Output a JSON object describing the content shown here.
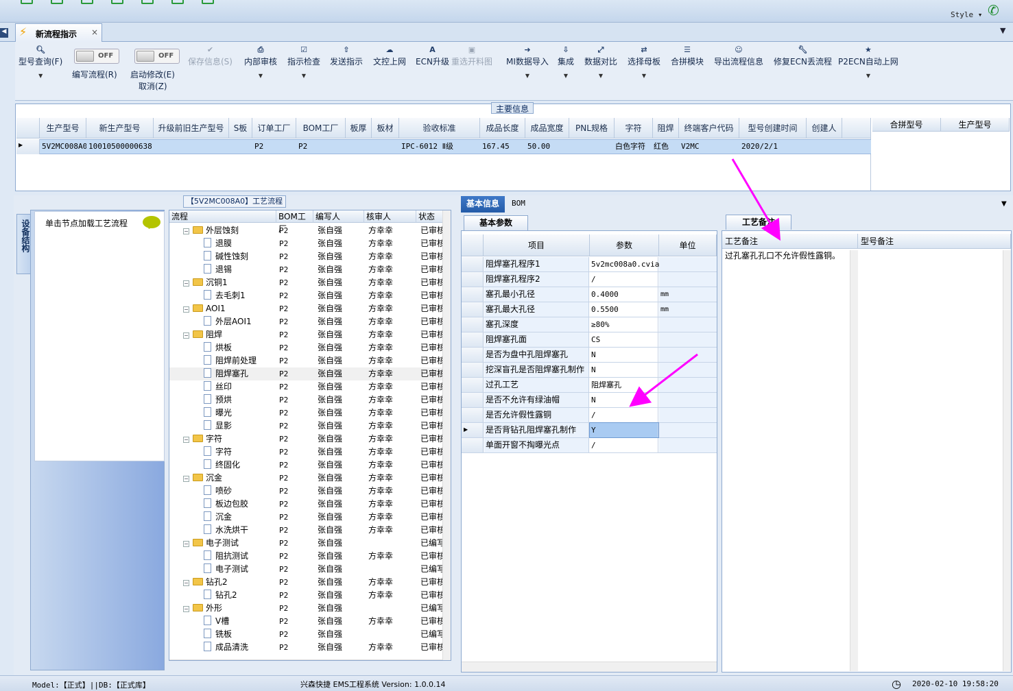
{
  "topbar": {
    "style_label": "Style",
    "style_arrow": "▾",
    "phone_icon": "phone-icon"
  },
  "tab": {
    "title": "新流程指示",
    "close": "×"
  },
  "ribbon": {
    "type_query": "型号查询(F)",
    "write_toggle": "OFF",
    "write_label": "编写流程(R)",
    "modify_toggle": "OFF",
    "modify_label": "启动修改(E)",
    "cancel_label": "取消(Z)",
    "save_info": "保存信息(S)",
    "internal_review": "内部审核",
    "indicate_check": "指示检查",
    "send_indicate": "发送指示",
    "doc_upload": "文控上网",
    "ecn_upgrade": "ECN升级",
    "reselect_cut": "重选开料图",
    "mi_import": "MI数据导入",
    "integrate": "集成",
    "data_compare": "数据对比",
    "select_mother": "选择母板",
    "merge_module": "合拼模块",
    "export_info": "导出流程信息",
    "fix_ecn": "修复ECN丢流程",
    "p2ecn": "P2ECN自动上网"
  },
  "main_info": {
    "title": "主要信息",
    "headers": [
      "生产型号",
      "新生产型号",
      "升级前旧生产型号",
      "S板",
      "订单工厂",
      "BOM工厂",
      "板厚",
      "板材",
      "验收标准",
      "成品长度",
      "成品宽度",
      "PNL规格",
      "字符",
      "阻焊",
      "终端客户代码",
      "型号创建时间",
      "创建人"
    ],
    "row": [
      "5V2MC008A0",
      "10010500000638",
      "",
      "",
      "P2",
      "P2",
      "",
      "",
      "IPC-6012 Ⅱ级",
      "167.45",
      "50.00",
      "",
      "白色字符",
      "红色",
      "V2MC",
      "2020/2/1",
      ""
    ],
    "merge_headers": [
      "合拼型号",
      "生产型号"
    ]
  },
  "device_panel": {
    "tab_label": "设备结构",
    "load_hint": "单击节点加载工艺流程"
  },
  "process": {
    "title": "【5V2MC008A0】工艺流程",
    "headers": [
      "流程",
      "BOM工厂",
      "编写人",
      "核审人",
      "状态"
    ],
    "rows": [
      {
        "name": "外层蚀刻",
        "bom": "P2",
        "writer": "张自强",
        "reviewer": "方幸幸",
        "status": "已审核"
      },
      {
        "name": "退膜",
        "bom": "P2",
        "writer": "张自强",
        "reviewer": "方幸幸",
        "status": "已审核"
      },
      {
        "name": "碱性蚀刻",
        "bom": "P2",
        "writer": "张自强",
        "reviewer": "方幸幸",
        "status": "已审核"
      },
      {
        "name": "退锡",
        "bom": "P2",
        "writer": "张自强",
        "reviewer": "方幸幸",
        "status": "已审核"
      },
      {
        "name": "沉铜1",
        "bom": "P2",
        "writer": "张自强",
        "reviewer": "方幸幸",
        "status": "已审核"
      },
      {
        "name": "去毛刺1",
        "bom": "P2",
        "writer": "张自强",
        "reviewer": "方幸幸",
        "status": "已审核"
      },
      {
        "name": "AOI1",
        "bom": "P2",
        "writer": "张自强",
        "reviewer": "方幸幸",
        "status": "已审核"
      },
      {
        "name": "外层AOI1",
        "bom": "P2",
        "writer": "张自强",
        "reviewer": "方幸幸",
        "status": "已审核"
      },
      {
        "name": "阻焊",
        "bom": "P2",
        "writer": "张自强",
        "reviewer": "方幸幸",
        "status": "已审核"
      },
      {
        "name": "烘板",
        "bom": "P2",
        "writer": "张自强",
        "reviewer": "方幸幸",
        "status": "已审核"
      },
      {
        "name": "阻焊前处理",
        "bom": "P2",
        "writer": "张自强",
        "reviewer": "方幸幸",
        "status": "已审核"
      },
      {
        "name": "阻焊塞孔",
        "bom": "P2",
        "writer": "张自强",
        "reviewer": "方幸幸",
        "status": "已审核"
      },
      {
        "name": "丝印",
        "bom": "P2",
        "writer": "张自强",
        "reviewer": "方幸幸",
        "status": "已审核"
      },
      {
        "name": "预烘",
        "bom": "P2",
        "writer": "张自强",
        "reviewer": "方幸幸",
        "status": "已审核"
      },
      {
        "name": "曝光",
        "bom": "P2",
        "writer": "张自强",
        "reviewer": "方幸幸",
        "status": "已审核"
      },
      {
        "name": "显影",
        "bom": "P2",
        "writer": "张自强",
        "reviewer": "方幸幸",
        "status": "已审核"
      },
      {
        "name": "字符",
        "bom": "P2",
        "writer": "张自强",
        "reviewer": "方幸幸",
        "status": "已审核"
      },
      {
        "name": "字符",
        "bom": "P2",
        "writer": "张自强",
        "reviewer": "方幸幸",
        "status": "已审核"
      },
      {
        "name": "终固化",
        "bom": "P2",
        "writer": "张自强",
        "reviewer": "方幸幸",
        "status": "已审核"
      },
      {
        "name": "沉金",
        "bom": "P2",
        "writer": "张自强",
        "reviewer": "方幸幸",
        "status": "已审核"
      },
      {
        "name": "喷砂",
        "bom": "P2",
        "writer": "张自强",
        "reviewer": "方幸幸",
        "status": "已审核"
      },
      {
        "name": "板边包胶",
        "bom": "P2",
        "writer": "张自强",
        "reviewer": "方幸幸",
        "status": "已审核"
      },
      {
        "name": "沉金",
        "bom": "P2",
        "writer": "张自强",
        "reviewer": "方幸幸",
        "status": "已审核"
      },
      {
        "name": "水洗烘干",
        "bom": "P2",
        "writer": "张自强",
        "reviewer": "方幸幸",
        "status": "已审核"
      },
      {
        "name": "电子测试",
        "bom": "P2",
        "writer": "张自强",
        "reviewer": "",
        "status": "已编写"
      },
      {
        "name": "阻抗测试",
        "bom": "P2",
        "writer": "张自强",
        "reviewer": "方幸幸",
        "status": "已审核"
      },
      {
        "name": "电子测试",
        "bom": "P2",
        "writer": "张自强",
        "reviewer": "",
        "status": "已编写"
      },
      {
        "name": "钻孔2",
        "bom": "P2",
        "writer": "张自强",
        "reviewer": "方幸幸",
        "status": "已审核"
      },
      {
        "name": "钻孔2",
        "bom": "P2",
        "writer": "张自强",
        "reviewer": "方幸幸",
        "status": "已审核"
      },
      {
        "name": "外形",
        "bom": "P2",
        "writer": "张自强",
        "reviewer": "",
        "status": "已编写"
      },
      {
        "name": "V槽",
        "bom": "P2",
        "writer": "张自强",
        "reviewer": "方幸幸",
        "status": "已审核"
      },
      {
        "name": "铣板",
        "bom": "P2",
        "writer": "张自强",
        "reviewer": "",
        "status": "已编写"
      },
      {
        "name": "成品清洗",
        "bom": "P2",
        "writer": "张自强",
        "reviewer": "方幸幸",
        "status": "已审核"
      }
    ]
  },
  "info_tabs": {
    "basic": "基本信息",
    "bom": "BOM"
  },
  "params": {
    "tab": "基本参数",
    "headers": [
      "项目",
      "参数",
      "单位"
    ],
    "rows": [
      {
        "name": "阻焊塞孔程序1",
        "value": "5v2mc008a0.cvia",
        "unit": ""
      },
      {
        "name": "阻焊塞孔程序2",
        "value": "/",
        "unit": ""
      },
      {
        "name": "塞孔最小孔径",
        "value": "0.4000",
        "unit": "mm"
      },
      {
        "name": "塞孔最大孔径",
        "value": "0.5500",
        "unit": "mm"
      },
      {
        "name": "塞孔深度",
        "value": "≥80%",
        "unit": ""
      },
      {
        "name": "阻焊塞孔面",
        "value": "CS",
        "unit": ""
      },
      {
        "name": "是否为盘中孔阻焊塞孔",
        "value": "N",
        "unit": ""
      },
      {
        "name": "挖深盲孔是否阻焊塞孔制作",
        "value": "N",
        "unit": ""
      },
      {
        "name": "过孔工艺",
        "value": "阻焊塞孔",
        "unit": ""
      },
      {
        "name": "是否不允许有绿油帽",
        "value": "N",
        "unit": ""
      },
      {
        "name": "是否允许假性露铜",
        "value": "/",
        "unit": ""
      },
      {
        "name": "是否背钻孔阻焊塞孔制作",
        "value": "Y",
        "unit": ""
      },
      {
        "name": "单面开窗不掏曝光点",
        "value": "/",
        "unit": ""
      }
    ]
  },
  "remarks": {
    "tab": "工艺备注",
    "headers": [
      "工艺备注",
      "型号备注"
    ],
    "text": "过孔塞孔孔口不允许假性露铜。"
  },
  "status": {
    "left": "Model:【正式】||DB:【正式库】",
    "center": "兴森快捷 EMS工程系统 Version: 1.0.0.14",
    "right": "2020-02-10 19:58:20"
  },
  "colors": {
    "accent": "#245ba8",
    "annotation": "#ff00ff",
    "selection": "#c5dcf5"
  }
}
